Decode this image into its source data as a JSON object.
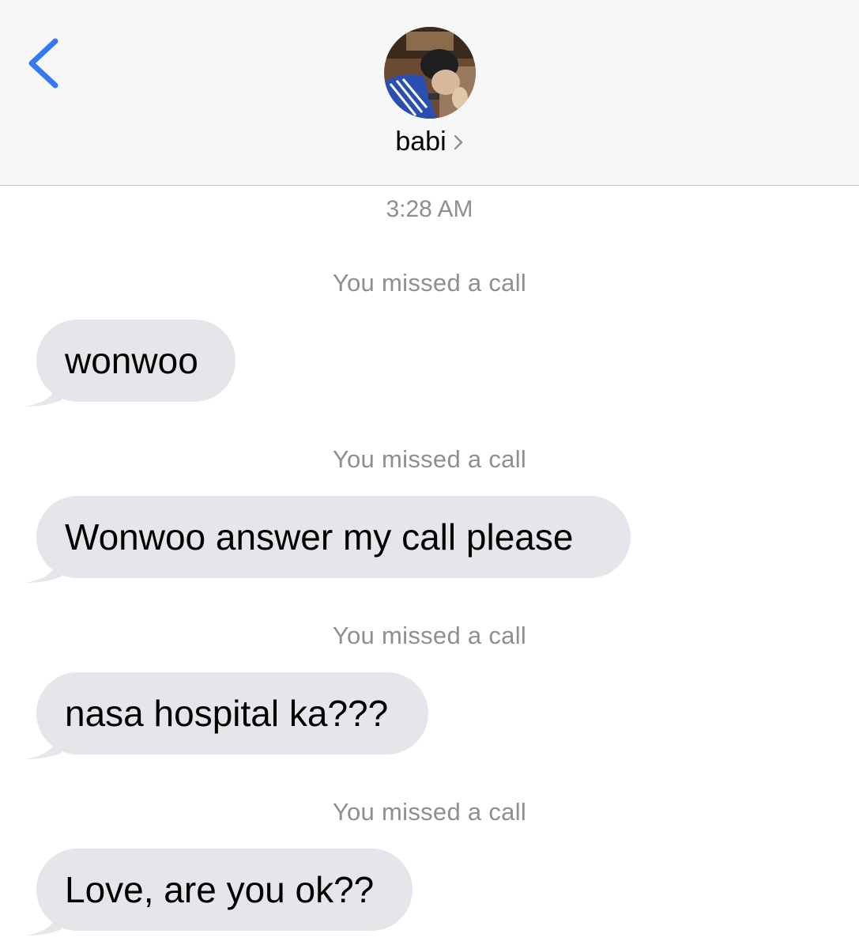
{
  "header": {
    "contact_name": "babi",
    "back_icon": "chevron-left-icon",
    "accent_color": "#3478f6"
  },
  "thread": {
    "timestamp": "3:28 AM",
    "items": [
      {
        "type": "system",
        "text": "You missed a call"
      },
      {
        "type": "incoming",
        "text": "wonwoo"
      },
      {
        "type": "system",
        "text": "You missed a call"
      },
      {
        "type": "incoming",
        "text": "Wonwoo answer my call please"
      },
      {
        "type": "system",
        "text": "You missed a call"
      },
      {
        "type": "incoming",
        "text": "nasa hospital ka???"
      },
      {
        "type": "system",
        "text": "You missed a call"
      },
      {
        "type": "incoming",
        "text": "Love, are you ok??"
      }
    ]
  }
}
